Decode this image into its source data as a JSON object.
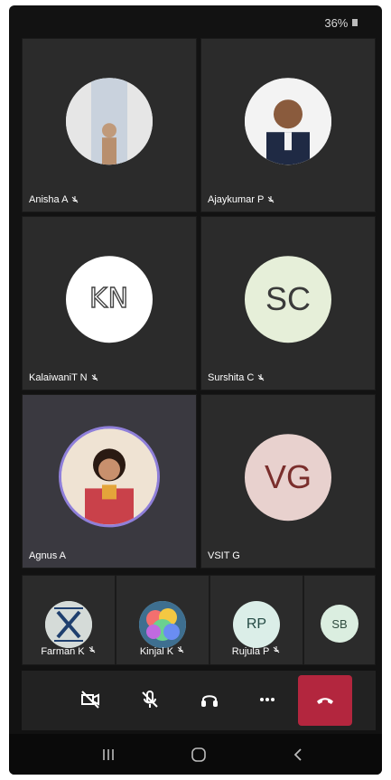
{
  "status": {
    "battery": "36%"
  },
  "participants": [
    {
      "name": "Anisha A",
      "initials": "",
      "avatar_bg": "#f1f1f1"
    },
    {
      "name": "Ajaykumar P",
      "initials": "",
      "avatar_bg": "#f1f1f1"
    },
    {
      "name": "KalaiwaniT N",
      "initials": "KN",
      "avatar_bg": "#ffffff"
    },
    {
      "name": "Surshita C",
      "initials": "SC",
      "avatar_bg": "#e6efd9"
    },
    {
      "name": "Agnus A",
      "initials": "",
      "avatar_bg": "#d9d3e8"
    },
    {
      "name": "VSIT G",
      "initials": "VG",
      "avatar_bg": "#e8d1ce"
    }
  ],
  "strip": [
    {
      "name": "Farman K",
      "initials": "",
      "avatar_bg": "#cfd9d6"
    },
    {
      "name": "Kinjal K",
      "initials": "",
      "avatar_bg": "#9ecbd6"
    },
    {
      "name": "Rujula P",
      "initials": "RP",
      "avatar_bg": "#dbeee8"
    },
    {
      "name": "",
      "initials": "SB",
      "avatar_bg": "#dbeee0"
    }
  ],
  "colors": {
    "accent_ring": "#8f7fd9",
    "hangup": "#b3263e",
    "tile": "#2b2b2b"
  }
}
